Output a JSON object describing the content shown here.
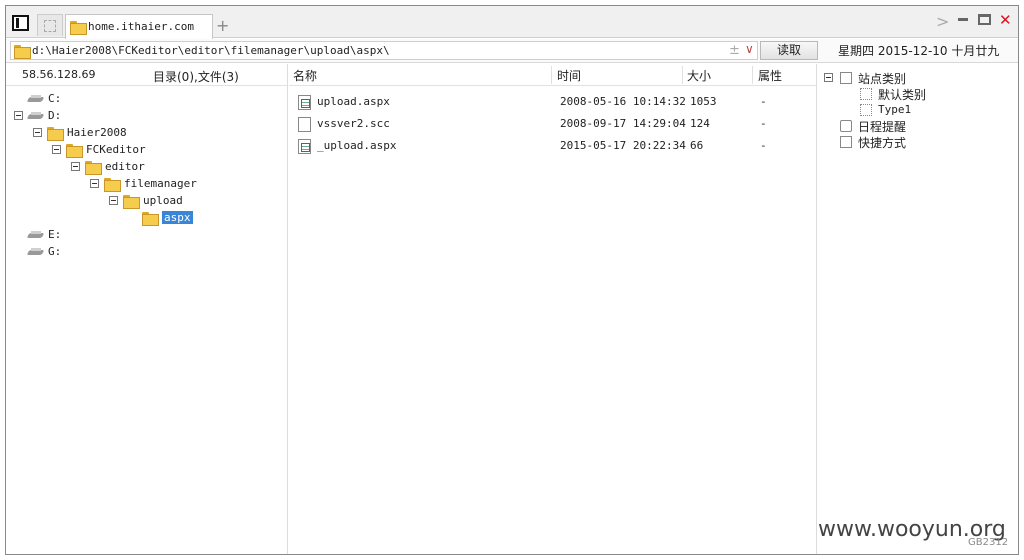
{
  "tabs": {
    "active_label": "home.ithaier.com",
    "new_tab": "+"
  },
  "window_controls": {
    "forward": ">",
    "minimize": "",
    "maximize": "",
    "close": "✕"
  },
  "address": {
    "path": "d:\\Haier2008\\FCKeditor\\editor\\filemanager\\upload\\aspx\\",
    "plus": "±",
    "dropdown": "∨",
    "read_label": "读取"
  },
  "date": "星期四 2015-12-10 十月廿九",
  "left": {
    "ip": "58.56.128.69",
    "count": "目录(0),文件(3)",
    "tree": [
      {
        "label": "C:",
        "kind": "drive",
        "level": 0,
        "expander": false
      },
      {
        "label": "D:",
        "kind": "drive",
        "level": 0,
        "expander": true
      },
      {
        "label": "Haier2008",
        "kind": "folder",
        "level": 1,
        "expander": true
      },
      {
        "label": "FCKeditor",
        "kind": "folder",
        "level": 2,
        "expander": true
      },
      {
        "label": "editor",
        "kind": "folder",
        "level": 3,
        "expander": true
      },
      {
        "label": "filemanager",
        "kind": "folder",
        "level": 4,
        "expander": true
      },
      {
        "label": "upload",
        "kind": "folder",
        "level": 5,
        "expander": true
      },
      {
        "label": "aspx",
        "kind": "folder",
        "level": 6,
        "expander": false,
        "selected": true
      },
      {
        "label": "E:",
        "kind": "drive",
        "level": 0,
        "expander": false
      },
      {
        "label": "G:",
        "kind": "drive",
        "level": 0,
        "expander": false
      }
    ]
  },
  "files": {
    "headers": {
      "name": "名称",
      "time": "时间",
      "size": "大小",
      "attr": "属性"
    },
    "rows": [
      {
        "name": "upload.aspx",
        "time": "2008-05-16 10:14:32",
        "size": "1053",
        "attr": "-",
        "icon": "aspx"
      },
      {
        "name": "vssver2.scc",
        "time": "2008-09-17 14:29:04",
        "size": "124",
        "attr": "-",
        "icon": "blank"
      },
      {
        "name": "_upload.aspx",
        "time": "2015-05-17 20:22:34",
        "size": "66",
        "attr": "-",
        "icon": "aspx"
      }
    ]
  },
  "side": {
    "site_category": "站点类别",
    "default_category": "默认类别",
    "type1": "Type1",
    "schedule": "日程提醒",
    "shortcuts": "快捷方式"
  },
  "watermark": "www.wooyun.org",
  "encoding": "GB2312"
}
